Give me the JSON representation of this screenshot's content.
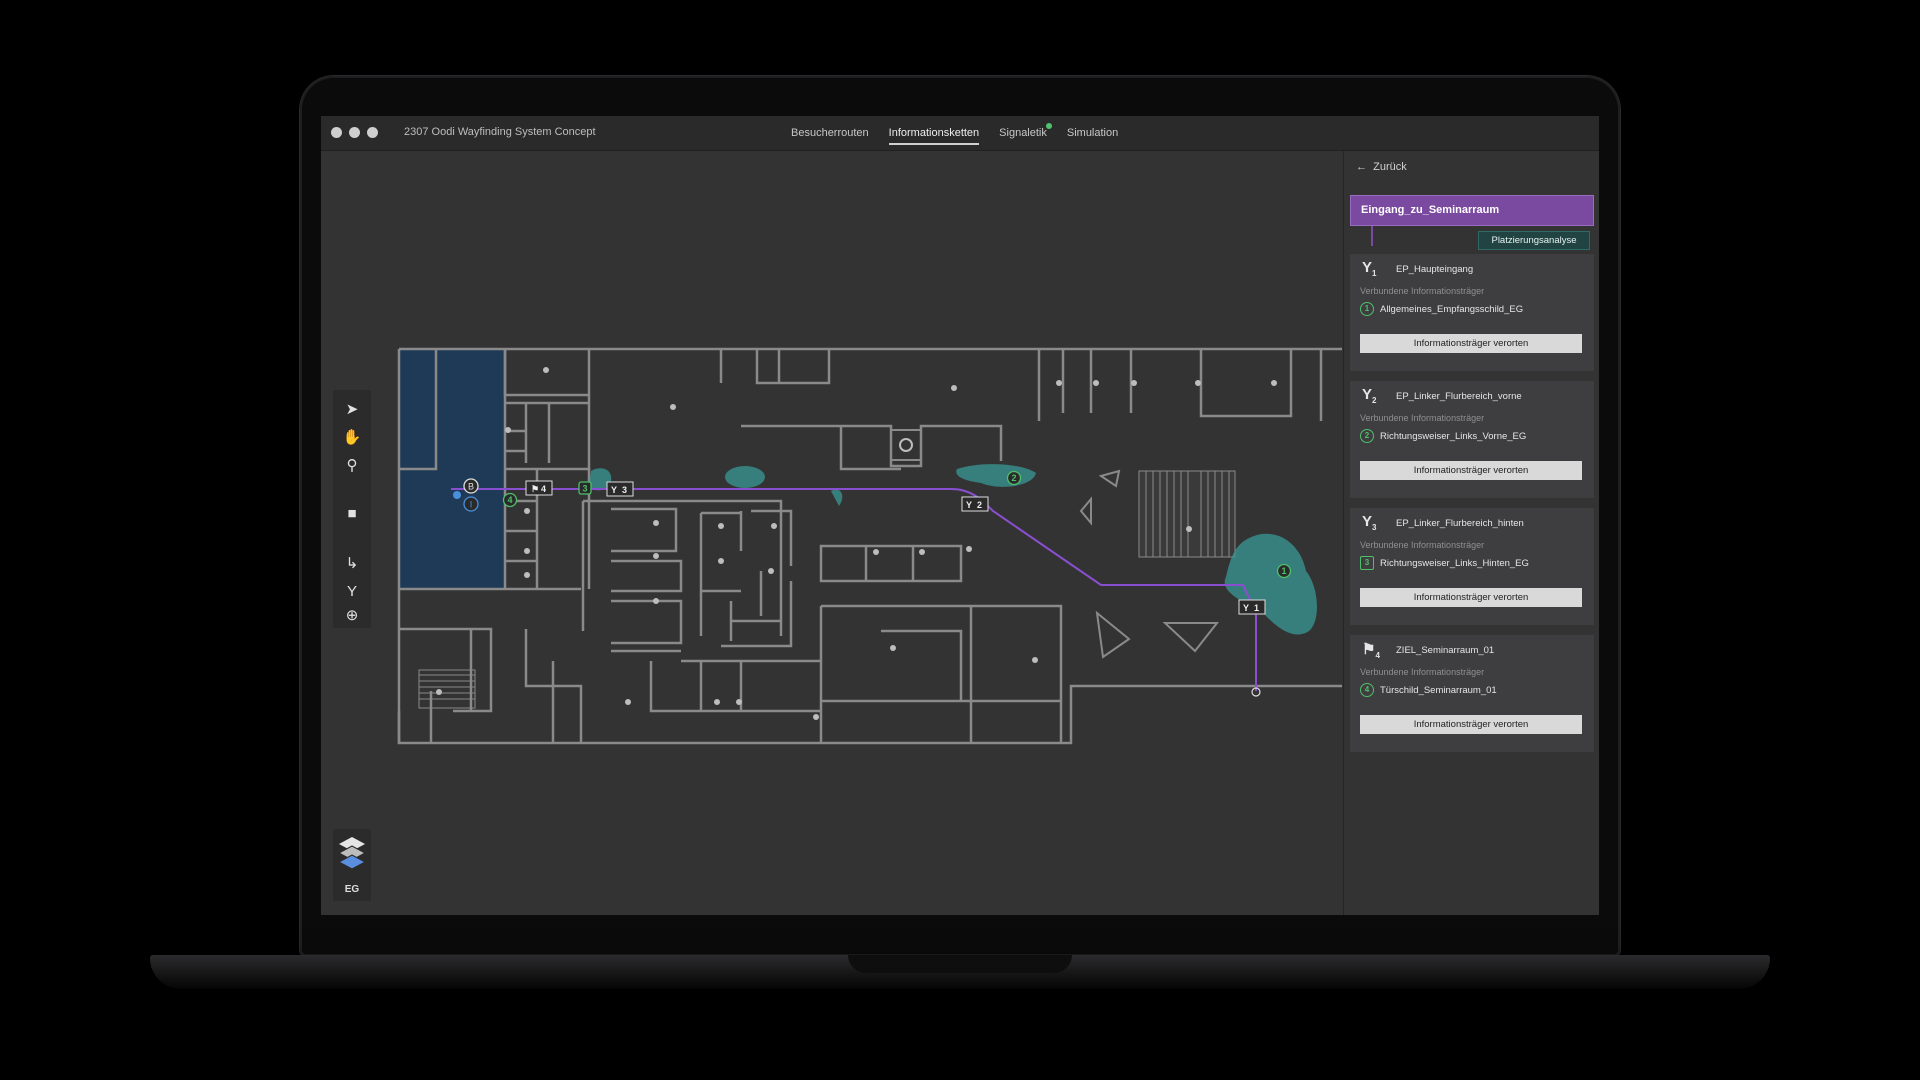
{
  "window": {
    "title": "2307 Oodi Wayfinding System Concept"
  },
  "nav": {
    "tabs": [
      {
        "label": "Besucherrouten"
      },
      {
        "label": "Informationsketten",
        "active": true
      },
      {
        "label": "Signaletik",
        "badge": true
      },
      {
        "label": "Simulation"
      }
    ]
  },
  "toolbar": {
    "tools": [
      "pointer-icon",
      "hand-icon",
      "zoom-icon",
      "note-icon",
      "route-point-icon",
      "decision-point-icon",
      "add-icon"
    ]
  },
  "layers": {
    "floor": "EG"
  },
  "map": {
    "markers": {
      "b": "B",
      "i": "I",
      "flag4": "4",
      "dp3": "3",
      "dp2": "2",
      "dp1": "1",
      "c1": "1",
      "c2": "2",
      "c3": "3",
      "c4": "4"
    }
  },
  "sidebar": {
    "back_label": "Zurück",
    "chain_title": "Eingang_zu_Seminarraum",
    "analysis_button": "Platzierungsanalyse",
    "connected_label": "Verbundene Informationsträger",
    "locate_button": "Informationsträger verorten",
    "points": [
      {
        "index": "1",
        "icon": "decision-point-icon",
        "title": "EP_Haupteingang",
        "carrier_num": "1",
        "carrier": "Allgemeines_Empfangsschild_EG"
      },
      {
        "index": "2",
        "icon": "decision-point-icon",
        "title": "EP_Linker_Flurbereich_vorne",
        "carrier_num": "2",
        "carrier": "Richtungsweiser_Links_Vorne_EG"
      },
      {
        "index": "3",
        "icon": "decision-point-icon",
        "title": "EP_Linker_Flurbereich_hinten",
        "carrier_num": "3",
        "carrier": "Richtungsweiser_Links_Hinten_EG"
      },
      {
        "index": "4",
        "icon": "goal-flag-icon",
        "title": "ZIEL_Seminarraum_01",
        "carrier_num": "4",
        "carrier": "Türschild_Seminarraum_01"
      }
    ]
  },
  "colors": {
    "route": "#8a4fd0",
    "heat": "#3a9a95",
    "chain": "#7a4aa0",
    "carrier": "#4fbf6a"
  }
}
